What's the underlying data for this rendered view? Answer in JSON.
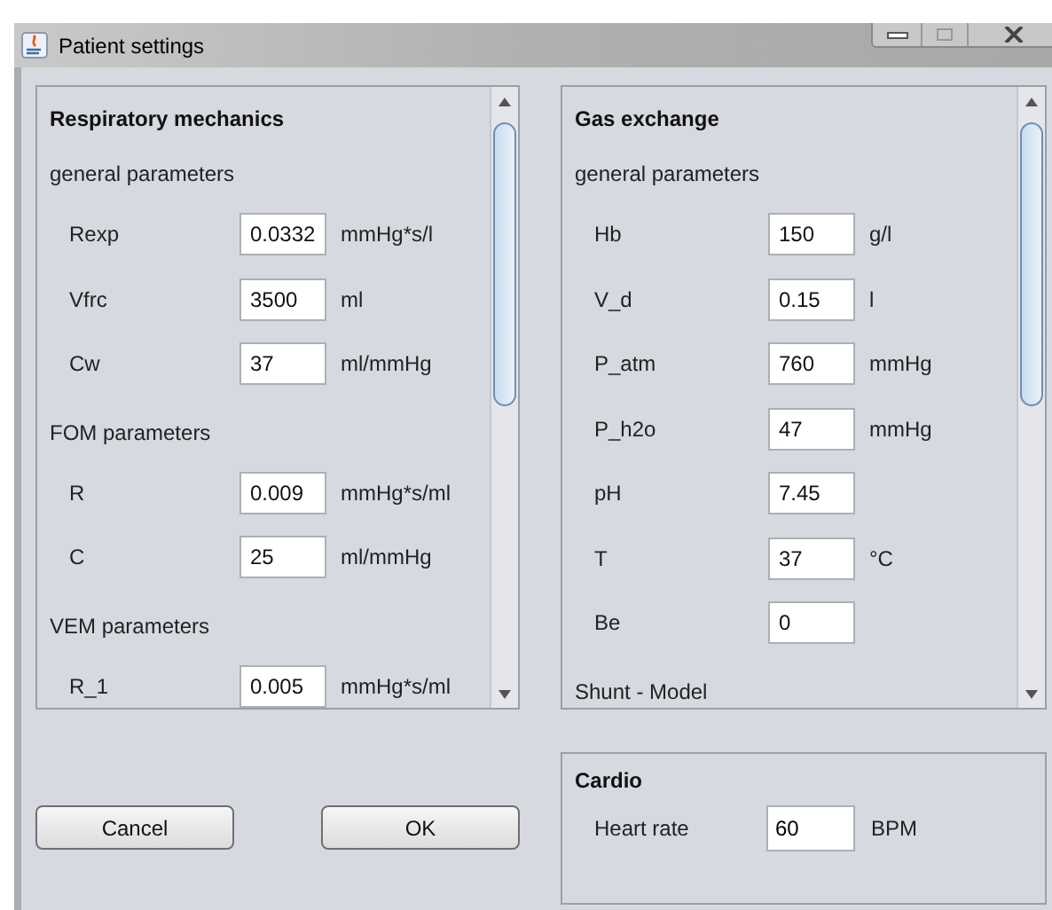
{
  "window": {
    "title": "Patient settings"
  },
  "panels": [
    {
      "title": "Respiratory mechanics",
      "rows": [
        {
          "kind": "section",
          "label": "general parameters"
        },
        {
          "kind": "param",
          "label": "Rexp",
          "value": "0.0332",
          "unit": "mmHg*s/l"
        },
        {
          "kind": "param",
          "label": "Vfrc",
          "value": "3500",
          "unit": "ml"
        },
        {
          "kind": "param",
          "label": "Cw",
          "value": "37",
          "unit": "ml/mmHg"
        },
        {
          "kind": "section",
          "label": "FOM parameters"
        },
        {
          "kind": "param",
          "label": "R",
          "value": "0.009",
          "unit": "mmHg*s/ml"
        },
        {
          "kind": "param",
          "label": "C",
          "value": "25",
          "unit": "ml/mmHg"
        },
        {
          "kind": "section",
          "label": "VEM parameters"
        },
        {
          "kind": "param",
          "label": "R_1",
          "value": "0.005",
          "unit": "mmHg*s/ml"
        }
      ]
    },
    {
      "title": "Gas exchange",
      "rows": [
        {
          "kind": "section",
          "label": "general parameters"
        },
        {
          "kind": "param",
          "label": "Hb",
          "value": "150",
          "unit": "g/l"
        },
        {
          "kind": "param",
          "label": "V_d",
          "value": "0.15",
          "unit": "l"
        },
        {
          "kind": "param",
          "label": "P_atm",
          "value": "760",
          "unit": "mmHg"
        },
        {
          "kind": "param",
          "label": "P_h2o",
          "value": "47",
          "unit": "mmHg"
        },
        {
          "kind": "param",
          "label": "pH",
          "value": "7.45"
        },
        {
          "kind": "param",
          "label": "T",
          "value": "37",
          "unit": "°C"
        },
        {
          "kind": "param",
          "label": "Be",
          "value": "0"
        },
        {
          "kind": "section",
          "label": "Shunt - Model"
        }
      ]
    }
  ],
  "buttons": [
    "Cancel",
    "OK"
  ],
  "cardio": {
    "title": "Cardio",
    "label": "Heart rate",
    "value": "60",
    "unit": "BPM"
  }
}
